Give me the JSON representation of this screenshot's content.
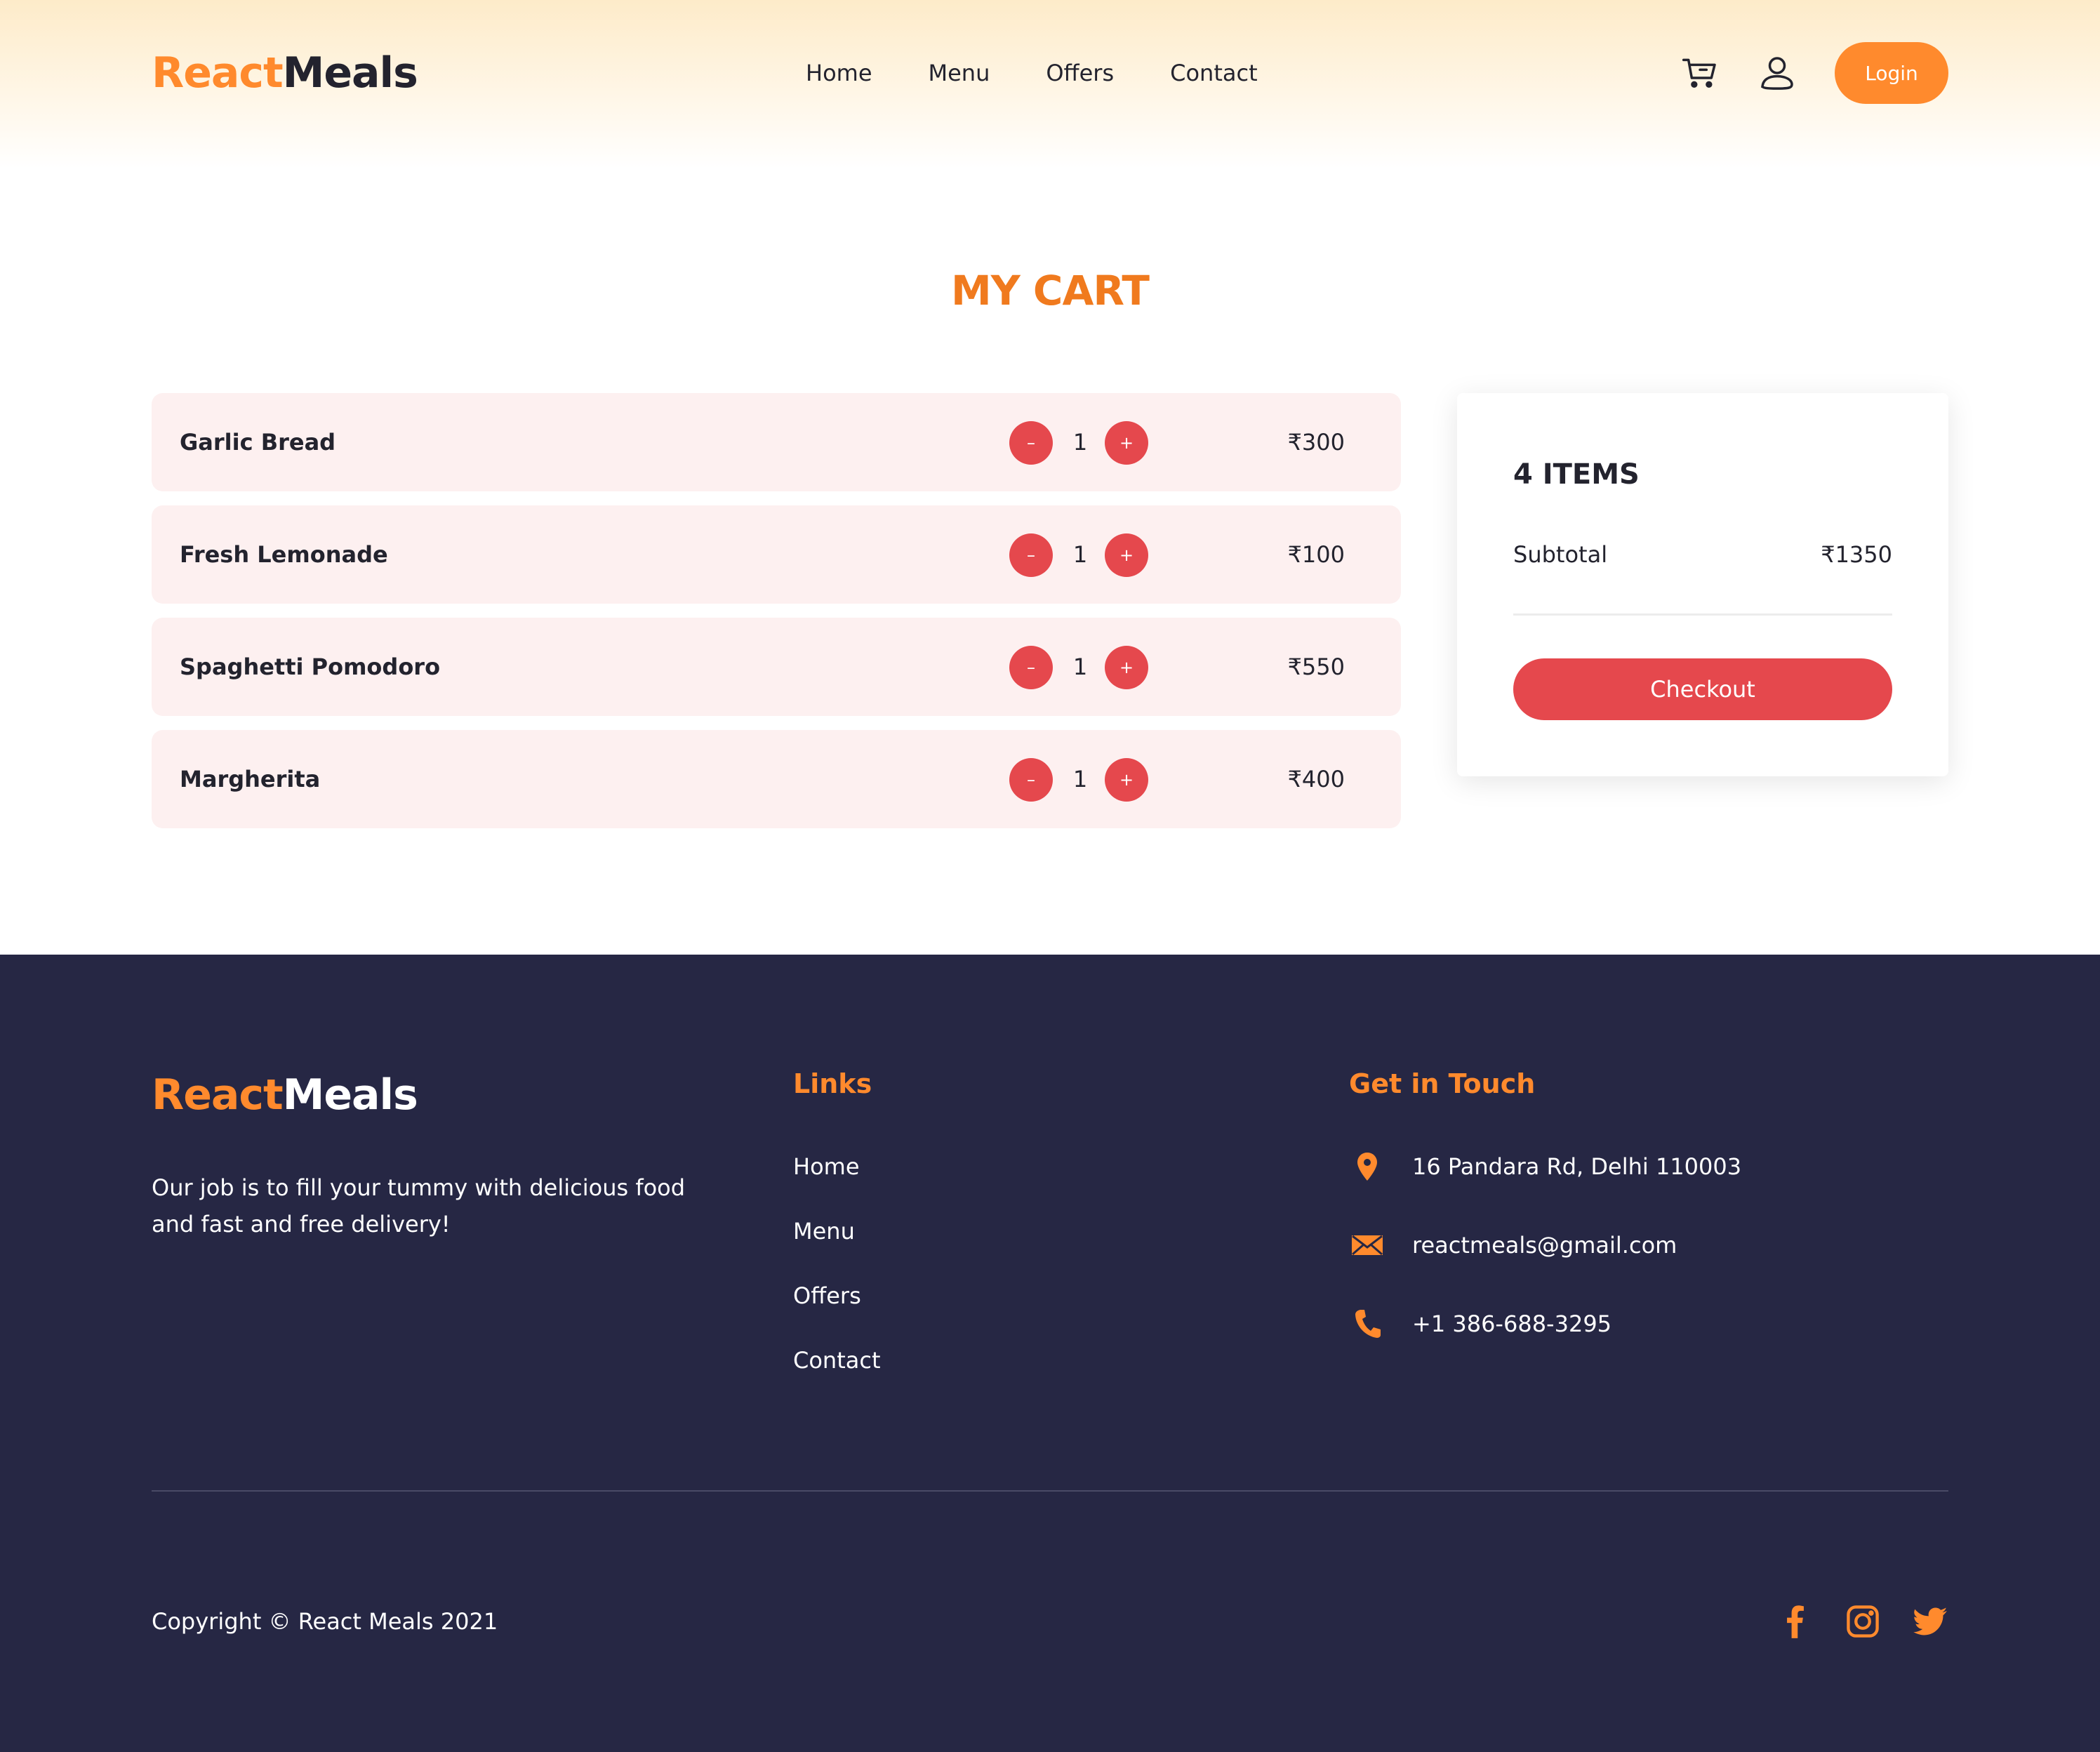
{
  "brand": {
    "name_part1": "React",
    "name_part2": "Meals"
  },
  "nav": {
    "items": [
      {
        "label": "Home"
      },
      {
        "label": "Menu"
      },
      {
        "label": "Offers"
      },
      {
        "label": "Contact"
      }
    ],
    "login_label": "Login",
    "icons": [
      "cart-icon",
      "user-icon"
    ]
  },
  "cart": {
    "title": "MY CART",
    "items": [
      {
        "name": "Garlic Bread",
        "quantity": "1",
        "price": "₹300",
        "minus": "–",
        "plus": "+"
      },
      {
        "name": "Fresh Lemonade",
        "quantity": "1",
        "price": "₹100",
        "minus": "–",
        "plus": "+"
      },
      {
        "name": "Spaghetti Pomodoro",
        "quantity": "1",
        "price": "₹550",
        "minus": "–",
        "plus": "+"
      },
      {
        "name": "Margherita",
        "quantity": "1",
        "price": "₹400",
        "minus": "–",
        "plus": "+"
      }
    ]
  },
  "summary": {
    "count_label": "4 ITEMS",
    "subtotal_label": "Subtotal",
    "subtotal_value": "₹1350",
    "checkout_label": "Checkout"
  },
  "footer": {
    "brand_part1": "React",
    "brand_part2": "Meals",
    "tagline": "Our job is to fill your tummy with delicious food and fast and free delivery!",
    "links_title": "Links",
    "links": [
      {
        "label": "Home"
      },
      {
        "label": "Menu"
      },
      {
        "label": "Offers"
      },
      {
        "label": "Contact"
      }
    ],
    "contact_title": "Get in Touch",
    "address": "16 Pandara Rd, Delhi 110003",
    "email": "reactmeals@gmail.com",
    "phone": "+1 386-688-3295",
    "copyright": "Copyright © React Meals 2021",
    "social_icons": [
      "facebook-icon",
      "instagram-icon",
      "twitter-icon"
    ]
  },
  "colors": {
    "accent_orange": "#ff8a2d",
    "button_red": "#e5484d",
    "footer_bg": "#262744",
    "row_bg": "#fdf0f0"
  }
}
